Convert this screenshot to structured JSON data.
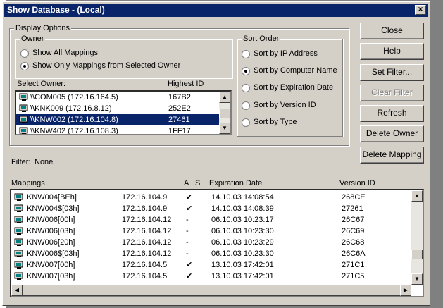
{
  "window": {
    "title": "Show Database - (Local)",
    "close_glyph": "×"
  },
  "display_options": {
    "legend": "Display Options",
    "owner_group": {
      "legend": "Owner",
      "options": [
        {
          "label": "Show All Mappings",
          "selected": false
        },
        {
          "label": "Show Only Mappings from Selected Owner",
          "selected": true
        }
      ]
    },
    "select_owner_label": "Select Owner:",
    "highest_id_label": "Highest ID",
    "owners": [
      {
        "name": "\\\\COM005 (172.16.164.5)",
        "id": "167B2",
        "selected": false
      },
      {
        "name": "\\\\KNK009 (172.16.8.12)",
        "id": "252E2",
        "selected": false
      },
      {
        "name": "\\\\KNW002 (172.16.104.8)",
        "id": "27461",
        "selected": true
      },
      {
        "name": "\\\\KNW402 (172.16.108.3)",
        "id": "1FF17",
        "selected": false
      }
    ],
    "sort_order": {
      "legend": "Sort Order",
      "options": [
        {
          "label": "Sort by IP Address",
          "selected": false
        },
        {
          "label": "Sort by Computer Name",
          "selected": true
        },
        {
          "label": "Sort by Expiration Date",
          "selected": false
        },
        {
          "label": "Sort by Version ID",
          "selected": false
        },
        {
          "label": "Sort by Type",
          "selected": false
        }
      ]
    }
  },
  "buttons": [
    {
      "label": "Close",
      "enabled": true
    },
    {
      "label": "Help",
      "enabled": true
    },
    {
      "label": "Set Filter...",
      "enabled": true
    },
    {
      "label": "Clear Filter",
      "enabled": false
    },
    {
      "label": "Refresh",
      "enabled": true
    },
    {
      "label": "Delete Owner",
      "enabled": true
    },
    {
      "label": "Delete Mapping",
      "enabled": true
    }
  ],
  "filter": {
    "label": "Filter:",
    "value": "None"
  },
  "mappings": {
    "headers": {
      "mappings": "Mappings",
      "a": "A",
      "s": "S",
      "expiration": "Expiration Date",
      "version": "Version ID"
    },
    "rows": [
      {
        "name": "KNW004[BEh]",
        "ip": "172.16.104.9",
        "a": "✔",
        "s": "",
        "exp": "14.10.03 14:08:54",
        "ver": "268CE"
      },
      {
        "name": "KNW004$[03h]",
        "ip": "172.16.104.9",
        "a": "✔",
        "s": "",
        "exp": "14.10.03 14:08:39",
        "ver": "27261"
      },
      {
        "name": "KNW006[00h]",
        "ip": "172.16.104.12",
        "a": "-",
        "s": "",
        "exp": "06.10.03 10:23:17",
        "ver": "26C67"
      },
      {
        "name": "KNW006[03h]",
        "ip": "172.16.104.12",
        "a": "-",
        "s": "",
        "exp": "06.10.03 10:23:30",
        "ver": "26C69"
      },
      {
        "name": "KNW006[20h]",
        "ip": "172.16.104.12",
        "a": "-",
        "s": "",
        "exp": "06.10.03 10:23:29",
        "ver": "26C68"
      },
      {
        "name": "KNW006$[03h]",
        "ip": "172.16.104.12",
        "a": "-",
        "s": "",
        "exp": "06.10.03 10:23:30",
        "ver": "26C6A"
      },
      {
        "name": "KNW007[00h]",
        "ip": "172.16.104.5",
        "a": "✔",
        "s": "",
        "exp": "13.10.03 17:42:01",
        "ver": "271C1"
      },
      {
        "name": "KNW007[03h]",
        "ip": "172.16.104.5",
        "a": "✔",
        "s": "",
        "exp": "13.10.03 17:42:01",
        "ver": "271C5"
      }
    ]
  },
  "icons": {
    "computer": "computer-icon",
    "scroll_up": "▲",
    "scroll_down": "▼",
    "scroll_left": "◀",
    "scroll_right": "▶"
  },
  "colors": {
    "selection": "#0a246a",
    "face": "#d4d0c8"
  }
}
